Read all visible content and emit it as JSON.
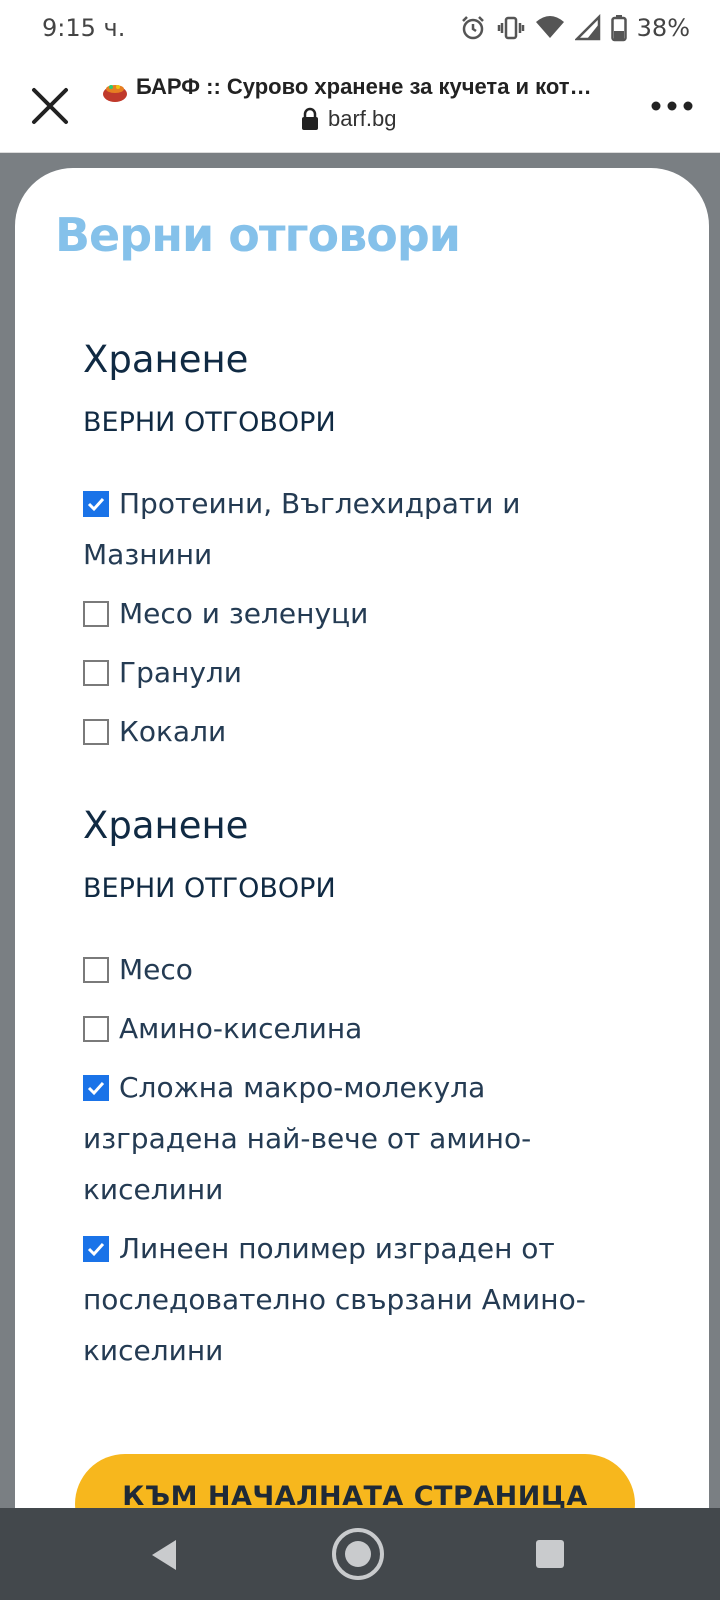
{
  "status_bar": {
    "time": "9:15 ч.",
    "battery_percent": "38%",
    "icons": [
      "alarm-icon",
      "vibrate-icon",
      "wifi-icon",
      "signal-icon",
      "battery-icon"
    ]
  },
  "browser": {
    "page_title": "БАРФ :: Сурово хранене за кучета и кот…",
    "url": "barf.bg",
    "icons": [
      "close-icon",
      "site-favicon-icon",
      "lock-icon",
      "more-icon"
    ]
  },
  "card": {
    "heading": "Верни отговори",
    "sections": [
      {
        "title": "Хранене",
        "subtitle": "ВЕРНИ ОТГОВОРИ",
        "answers": [
          {
            "text": "Протеини, Въглехидрати и Мазнини",
            "checked": true
          },
          {
            "text": "Месо и зеленуци",
            "checked": false
          },
          {
            "text": "Гранули",
            "checked": false
          },
          {
            "text": "Кокали",
            "checked": false
          }
        ]
      },
      {
        "title": "Хранене",
        "subtitle": "ВЕРНИ ОТГОВОРИ",
        "answers": [
          {
            "text": "Месо",
            "checked": false
          },
          {
            "text": "Амино-киселина",
            "checked": false
          },
          {
            "text": "Сложна макро-молекула изградена най-вече от амино-киселини",
            "checked": true
          },
          {
            "text": "Линеен полимер изграден от последователно свързани Амино-киселини",
            "checked": true
          }
        ]
      }
    ],
    "cta_label": "КЪМ НАЧАЛНАТА СТРАНИЦА",
    "colors": {
      "heading": "#85c1ea",
      "cta": "#f7b71d",
      "checkbox": "#1a73e8"
    }
  },
  "nav_bar": {
    "icons": [
      "back-icon",
      "home-icon",
      "recents-icon"
    ]
  }
}
